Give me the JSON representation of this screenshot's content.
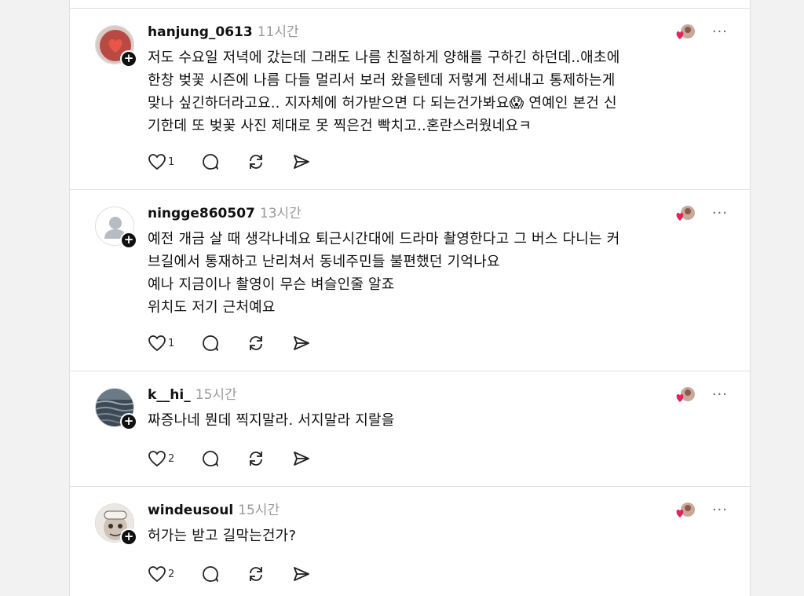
{
  "posts": [
    {
      "username": "hanjung_0613",
      "time": "11시간",
      "text": "저도 수요일 저녁에 갔는데 그래도 나름 친절하게 양해를 구하긴 하던데..애초에\n한창 벚꽃 시즌에 나름 다들 멀리서 보러 왔을텐데 저렇게 전세내고 통제하는게\n맞나 싶긴하더라고요.. 지자체에 허가받으면 다 되는건가봐요😱 연예인 본건 신\n기한데 또 벚꽃 사진 제대로 못 찍은건 빡치고..혼란스러웠네요ㅋ",
      "likes": "1",
      "avatar_icon": "red-heart-avatar"
    },
    {
      "username": "ningge860507",
      "time": "13시간",
      "text": "예전 개금 살 때 생각나네요 퇴근시간대에 드라마 촬영한다고 그 버스 다니는 커\n브길에서 통재하고 난리쳐서 동네주민들 불편했던 기억나요\n예나 지금이나 촬영이 무슨 벼슬인줄 알죠\n위치도 저기 근처예요",
      "likes": "1",
      "avatar_icon": "default-user-avatar"
    },
    {
      "username": "k__hi_",
      "time": "15시간",
      "text": "짜증나네 뭔데 찍지말라. 서지말라 지랄을",
      "likes": "2",
      "avatar_icon": "water-avatar"
    },
    {
      "username": "windeusoul",
      "time": "15시간",
      "text": "허가는 받고 길막는건가?",
      "likes": "2",
      "avatar_icon": "character-avatar"
    }
  ],
  "more_label": "···",
  "follow_label": "+",
  "colors": {
    "time": "#9a9a9a",
    "divider": "#e0e0e0",
    "heart_badge": "#e0245e"
  }
}
